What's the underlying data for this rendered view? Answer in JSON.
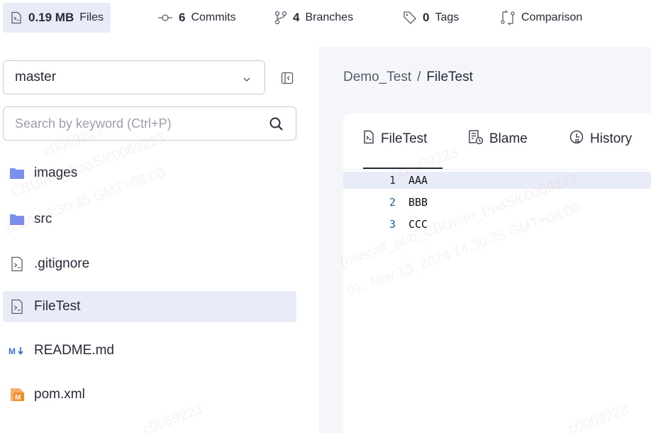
{
  "stats": {
    "files": {
      "num": "0.19 MB",
      "label": "Files"
    },
    "commits": {
      "num": "6",
      "label": "Commits"
    },
    "branches": {
      "num": "4",
      "label": "Branches"
    },
    "tags": {
      "num": "0",
      "label": "Tags"
    },
    "comparison": {
      "label": "Comparison"
    }
  },
  "sidebar": {
    "branch": "master",
    "search_placeholder": "Search by keyword (Ctrl+P)",
    "files": [
      {
        "name": "images",
        "icon": "folder-icon"
      },
      {
        "name": "src",
        "icon": "folder-icon"
      },
      {
        "name": ".gitignore",
        "icon": "file-code-icon"
      },
      {
        "name": "FileTest",
        "icon": "file-code-icon"
      },
      {
        "name": "README.md",
        "icon": "markdown-icon"
      },
      {
        "name": "pom.xml",
        "icon": "maven-icon"
      }
    ]
  },
  "breadcrumb": {
    "repo": "Demo_Test",
    "sep": "/",
    "file": "FileTest"
  },
  "tabs": {
    "file": "FileTest",
    "blame": "Blame",
    "history": "History"
  },
  "code": [
    {
      "n": "1",
      "text": "AAA"
    },
    {
      "n": "2",
      "text": "BBB"
    },
    {
      "n": "3",
      "text": "CCC"
    }
  ],
  "watermark": {
    "a": "c0069223",
    "b": "CBUInfo_PaaS/c0069223",
    "c": "2024 14:30:35 GMT+08:00",
    "d": "(hwstaff_pub_CBUInfo_PaaS/c0069223",
    "e": "0) , Nov 15, 2024 14:30:35 GMT+08:00"
  },
  "colors": {
    "accent_bg": "#e8ecf8",
    "folder": "#7b8ff0",
    "markdown": "#3f6fe0",
    "maven": "#f08a24"
  }
}
